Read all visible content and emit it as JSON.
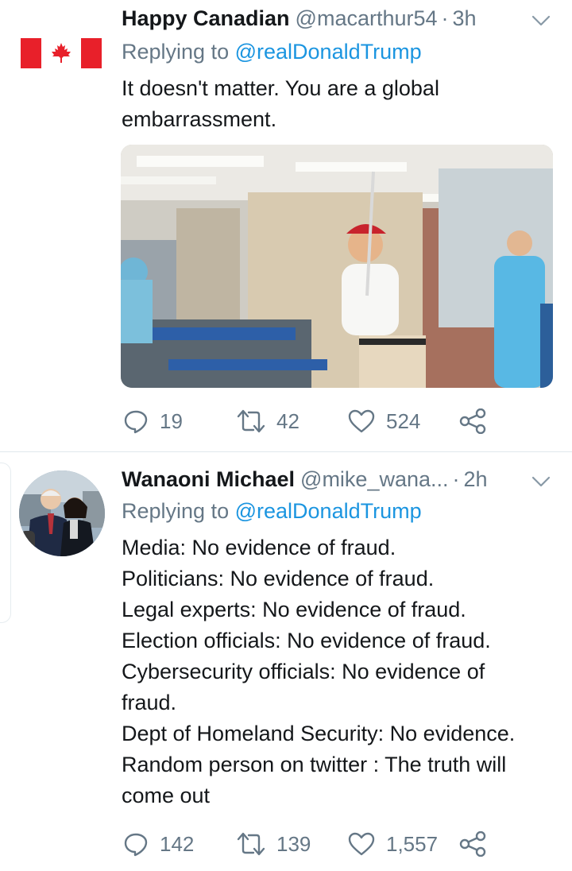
{
  "tweets": [
    {
      "author": {
        "name": "Happy Canadian",
        "handle": "@macarthur54",
        "avatar_icon": "canada-flag-icon"
      },
      "time": "3h",
      "replying_label": "Replying to",
      "replying_to": "@realDonaldTrump",
      "text_lines": [
        "It doesn't matter. You are a global",
        "embarrassment."
      ],
      "media_icon": "photo-golfer-in-hospital-ward",
      "stats": {
        "replies": "19",
        "retweets": "42",
        "likes": "524"
      }
    },
    {
      "author": {
        "name": "Wanaoni Michael",
        "handle": "@mike_wana...",
        "avatar_icon": "profile-photo-two-people"
      },
      "time": "2h",
      "replying_label": "Replying to",
      "replying_to": "@realDonaldTrump",
      "text_lines": [
        "Media: No evidence of fraud.",
        "Politicians: No evidence of fraud.",
        "Legal experts: No evidence of fraud.",
        "Election officials: No evidence of fraud.",
        "Cybersecurity officials: No evidence of",
        "fraud.",
        "Dept of Homeland Security: No evidence.",
        "Random person on twitter : The truth will",
        "come out"
      ],
      "stats": {
        "replies": "142",
        "retweets": "139",
        "likes": "1,557"
      }
    }
  ],
  "separator": "·",
  "colors": {
    "accent": "#1b95e0",
    "secondary_text": "#657786",
    "primary_text": "#14171a",
    "flag_red": "#e8202a"
  }
}
